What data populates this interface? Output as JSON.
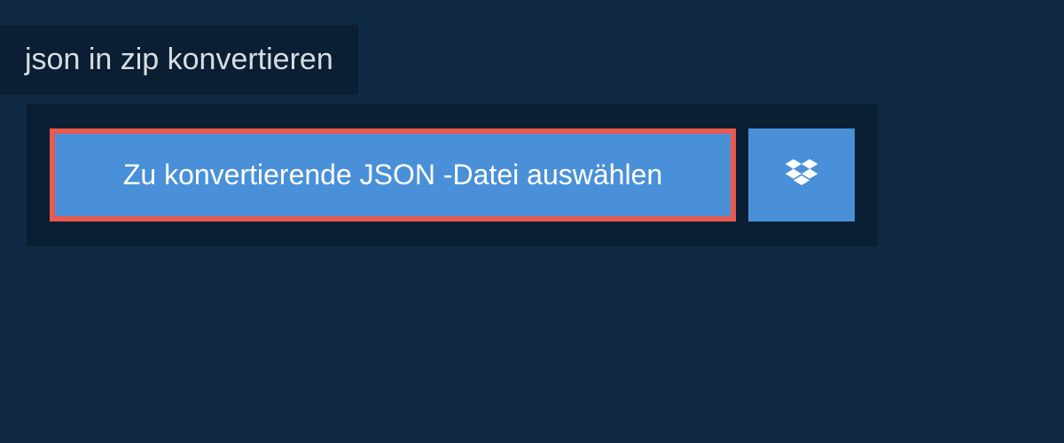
{
  "header": {
    "title": "json in zip konvertieren"
  },
  "actions": {
    "select_file_label": "Zu konvertierende JSON -Datei auswählen",
    "dropbox_icon_name": "dropbox"
  },
  "colors": {
    "background": "#0f2a42",
    "panel": "#0a1f33",
    "button": "#4a90d9",
    "highlight_border": "#e85a4f",
    "text_light": "#d8dde2",
    "text_white": "#ffffff"
  }
}
